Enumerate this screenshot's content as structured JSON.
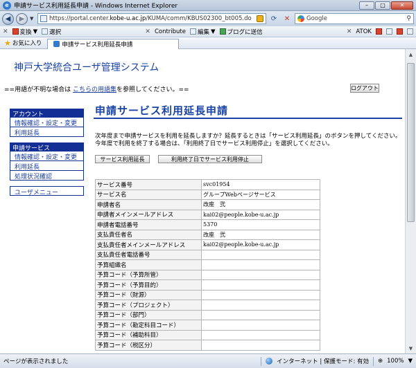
{
  "window": {
    "title": "申請サービス利用延長申請 - Windows Internet Explorer",
    "controls": [
      "–",
      "□",
      "✕"
    ]
  },
  "address": {
    "url_prefix": "https://portal.center.",
    "url_domain": "kobe-u.ac.jp",
    "url_path": "/KUMA/comm/KBUS02300_bt005.do",
    "search_placeholder": "Google"
  },
  "toolbar1": {
    "convert_label": "変換",
    "select_label": "選択",
    "contribute_label": "Contribute",
    "edit_label": "編集",
    "blog_label": "ブログに送信",
    "atok_label": "ATOK"
  },
  "favorites": {
    "favorites_label": "お気に入り",
    "tab_label": "申請サービス利用延長申請"
  },
  "page": {
    "system_title": "神戸大学統合ユーザ管理システム",
    "glossary_prefix": "==用語が不明な場合は",
    "glossary_link": "こちらの用語集",
    "glossary_suffix": "を参照してください。==",
    "logout_label": "ログアウト",
    "main_title": "申請サービス利用延長申請",
    "desc_line1": "次年度まで申請サービスを利用を延長しますか？延長するときは「サービス利用延長」のボタンを押してください。",
    "desc_line2": "今年度で利用を終了する場合は、「利用終了日でサービス利用停止」を選択してください。",
    "btn_extend": "サービス利用延長",
    "btn_stop": "利用終了日でサービス利用停止"
  },
  "sidebar": {
    "account_head": "アカウント",
    "account_items": [
      "情報確認・設定・変更",
      "利用延長"
    ],
    "service_head": "申請サービス",
    "service_items": [
      "情報確認・設定・変更",
      "利用延長",
      "処理状況確認"
    ],
    "user_menu": "ユーザメニュー"
  },
  "table": {
    "rows": [
      {
        "label": "サービス番号",
        "value": "svc01954"
      },
      {
        "label": "サービス名",
        "value": "グループWebページサービス"
      },
      {
        "label": "申請者名",
        "value": "改座　弐"
      },
      {
        "label": "申請者メインメールアドレス",
        "value": "kai02@people.kobe-u.ac.jp"
      },
      {
        "label": "申請者電話番号",
        "value": "5370"
      },
      {
        "label": "支払責任者名",
        "value": "改座　弐"
      },
      {
        "label": "支払責任者メインメールアドレス",
        "value": "kai02@people.kobe-u.ac.jp"
      },
      {
        "label": "支払責任者電話番号",
        "value": ""
      },
      {
        "label": "予算組織名",
        "value": ""
      },
      {
        "label": "予算コード（予算所管）",
        "value": ""
      },
      {
        "label": "予算コード（予算目的）",
        "value": ""
      },
      {
        "label": "予算コード（財源）",
        "value": ""
      },
      {
        "label": "予算コード（プロジェクト）",
        "value": ""
      },
      {
        "label": "予算コード（部門）",
        "value": ""
      },
      {
        "label": "予算コード（勘定科目コード）",
        "value": ""
      },
      {
        "label": "予算コード（補助科目）",
        "value": ""
      },
      {
        "label": "予算コード（税区分）",
        "value": ""
      }
    ]
  },
  "status": {
    "message": "ページが表示されました",
    "zone": "インターネット | 保護モード: 有効",
    "zoom": "100%"
  }
}
